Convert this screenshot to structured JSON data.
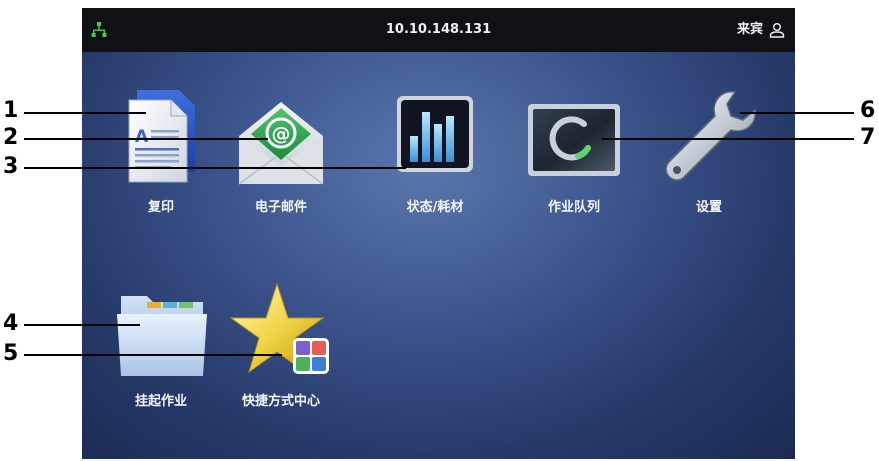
{
  "status_bar": {
    "ip_address": "10.10.148.131",
    "user_label": "来宾"
  },
  "apps": [
    {
      "label": "复印",
      "icon": "copy-icon"
    },
    {
      "label": "电子邮件",
      "icon": "email-icon"
    },
    {
      "label": "状态/耗材",
      "icon": "status-supplies-icon"
    },
    {
      "label": "作业队列",
      "icon": "job-queue-icon"
    },
    {
      "label": "设置",
      "icon": "settings-wrench-icon"
    },
    {
      "label": "挂起作业",
      "icon": "held-jobs-folder-icon"
    },
    {
      "label": "快捷方式中心",
      "icon": "shortcut-center-star-icon"
    }
  ],
  "callouts": [
    "1",
    "2",
    "3",
    "4",
    "5",
    "6",
    "7"
  ]
}
